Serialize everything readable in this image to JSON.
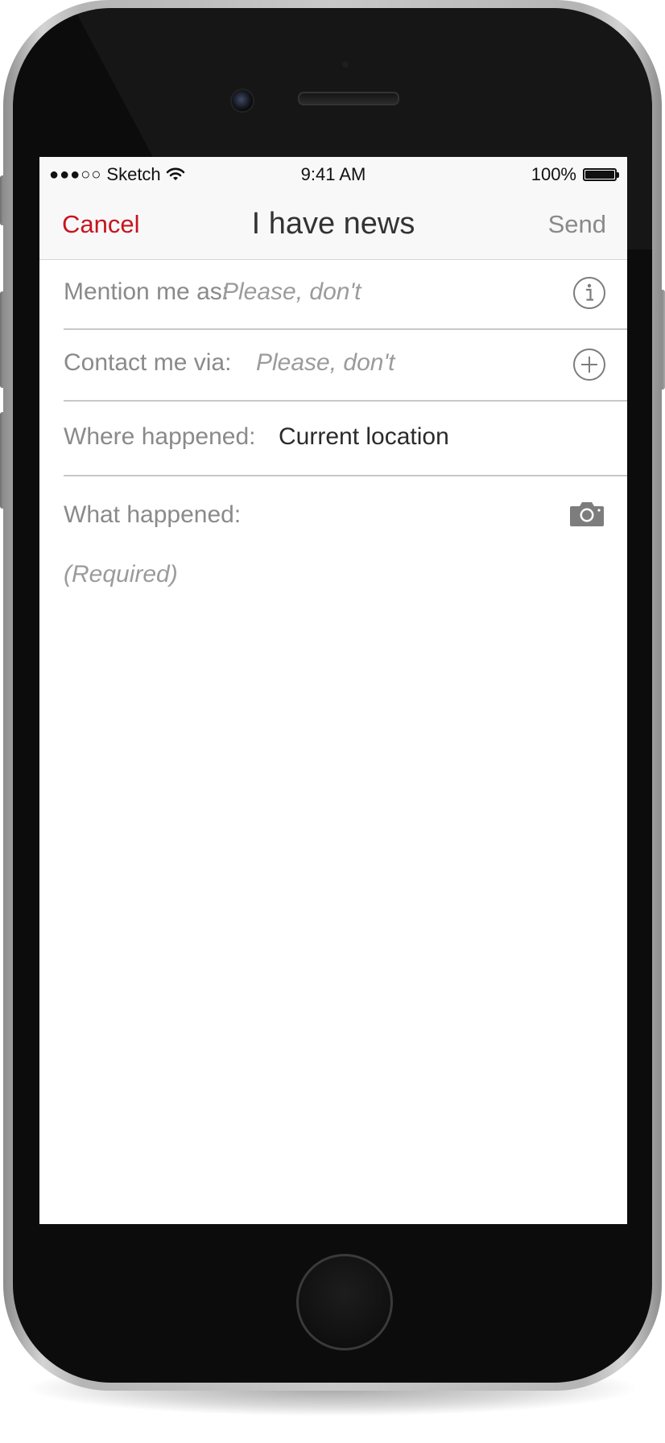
{
  "status_bar": {
    "signal": "●●●○○",
    "carrier": "Sketch",
    "time": "9:41 AM",
    "battery": "100%"
  },
  "nav": {
    "cancel_label": "Cancel",
    "title": "I have news",
    "send_label": "Send"
  },
  "form": {
    "mention": {
      "label": "Mention me as:",
      "placeholder": "Please, don't",
      "icon": "info-icon"
    },
    "contact": {
      "label": "Contact me via:",
      "placeholder": "Please, don't",
      "icon": "add-icon"
    },
    "where": {
      "label": "Where happened:",
      "value": "Current location"
    },
    "what": {
      "label": "What happened:",
      "placeholder": "(Required)",
      "icon": "camera-icon"
    }
  },
  "colors": {
    "accent": "#c8141e",
    "disabled": "#8a8a8a",
    "nav_background": "#f8f8f8"
  }
}
